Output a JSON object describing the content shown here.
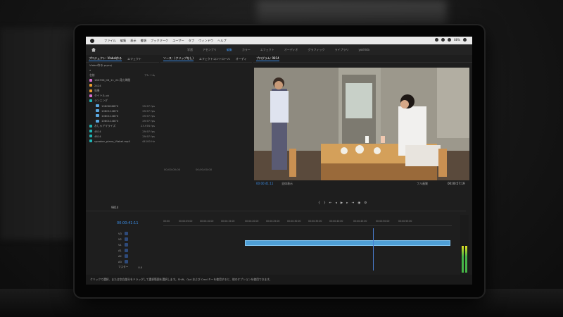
{
  "mac_menu": {
    "items": [
      "ファイル",
      "編集",
      "表示",
      "書類",
      "ブックマーク",
      "ユーザー",
      "タブ",
      "ウィンドウ",
      "ヘルプ"
    ],
    "battery": "88%"
  },
  "workspace": {
    "tabs": [
      "学習",
      "アセンブリ",
      "編集",
      "カラー",
      "エフェクト",
      "オーディオ",
      "グラフィック",
      "ライブラリ",
      "yoshida"
    ],
    "active_index": 2
  },
  "project_panel": {
    "header_tabs": [
      "プロジェクト: Vlabel作る",
      "エフェクト"
    ],
    "project_file": "Vlabel作る.prproj",
    "col_name": "名前",
    "col_fps": "フレーム",
    "items": [
      {
        "label": "180336_06_11_24.見た瞬間"
      },
      {
        "label": "2424"
      },
      {
        "label": "効果"
      },
      {
        "label": "タイトル.ok"
      },
      {
        "label": "ランニング"
      },
      {
        "label": "1080606870",
        "fps": "29.97 fps"
      },
      {
        "label": "1080114870",
        "fps": "29.97 fps"
      },
      {
        "label": "1080114870",
        "fps": "29.97 fps"
      },
      {
        "label": "1080114870",
        "fps": "29.97 fps"
      },
      {
        "label": "おしゃアマライズ",
        "fps": "23.976 fps"
      },
      {
        "label": "4814",
        "fps": "29.97 fps"
      },
      {
        "label": "4814",
        "fps": "29.97 fps"
      },
      {
        "label": "speaker_piano_Vlabel.mp4",
        "fps": "44100 Hz"
      }
    ]
  },
  "source_panel": {
    "header_tabs": [
      "ソース：(クリップなし)",
      "エフェクトコントロール",
      "オーディ"
    ],
    "timecode_left": "00;00;00;00",
    "timecode_right": "00;00;00;00"
  },
  "program_panel": {
    "title": "プログラム: 9814",
    "timecode": "00:00:41:11",
    "fit_label": "全体表示",
    "quality": "フル画質",
    "duration": "00:00:57:19"
  },
  "timeline": {
    "tab": "9814",
    "timecode": "00:00:41:11",
    "ruler": [
      "00:00",
      "00:00:05:00",
      "00:00:10:00",
      "00:00:15:00",
      "00:00:20:00",
      "00:00:25:00",
      "00:00:30:00",
      "00:00:35:00",
      "00:00:40:00",
      "00:00:45:00",
      "00:00:50:00",
      "00:00:55:00"
    ],
    "tracks": [
      "V3",
      "V2",
      "V1",
      "A1",
      "A2",
      "A3",
      "マスター"
    ],
    "master_value": "0.0"
  },
  "status_bar": {
    "text": "クリックで選択、または空白部分をドラッグして選択範囲を選択します。Shift、Opt および Cmd キーを使用すると、他のオプションを使用できます。"
  },
  "colors": {
    "accent": "#3b8fe9",
    "clip": "#4f9fd6"
  }
}
